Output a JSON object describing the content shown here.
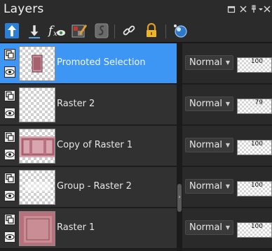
{
  "panel": {
    "title": "Layers",
    "window_buttons": [
      "restore-icon",
      "close-icon",
      "pin-icon",
      "menu-icon",
      "close-icon"
    ]
  },
  "toolbar": {
    "tools": [
      {
        "name": "arrange-up-icon",
        "label": "Move layer up"
      },
      {
        "name": "arrange-down-icon",
        "label": "Move layer down"
      },
      {
        "name": "fx-eye-icon",
        "label": "Layer effects visibility"
      },
      {
        "name": "edit-layer-icon",
        "label": "Edit layer"
      },
      {
        "name": "script-icon",
        "label": "Layer style"
      },
      {
        "name": "link-icon",
        "label": "Link layers"
      },
      {
        "name": "lock-icon",
        "label": "Lock layer"
      },
      {
        "name": "mask-circle-icon",
        "label": "Mask"
      }
    ]
  },
  "layers": [
    {
      "name": "Promoted Selection",
      "blend_mode": "Normal",
      "opacity": 100,
      "selected": true,
      "thumb": "small-pattern"
    },
    {
      "name": "Raster 2",
      "blend_mode": "Normal",
      "opacity": 79,
      "selected": false,
      "thumb": "transparent"
    },
    {
      "name": "Copy of Raster 1",
      "blend_mode": "Normal",
      "opacity": 100,
      "selected": false,
      "thumb": "pink-frame"
    },
    {
      "name": "Group - Raster 2",
      "blend_mode": "Normal",
      "opacity": 100,
      "selected": false,
      "thumb": "transparent-faint"
    },
    {
      "name": "Raster 1",
      "blend_mode": "Normal",
      "opacity": 100,
      "selected": false,
      "thumb": "pink-texture"
    }
  ],
  "colors": {
    "selected": "#3e96f4",
    "row": "#313131",
    "panel": "#2b2b2b",
    "pink": "#c98a95"
  }
}
